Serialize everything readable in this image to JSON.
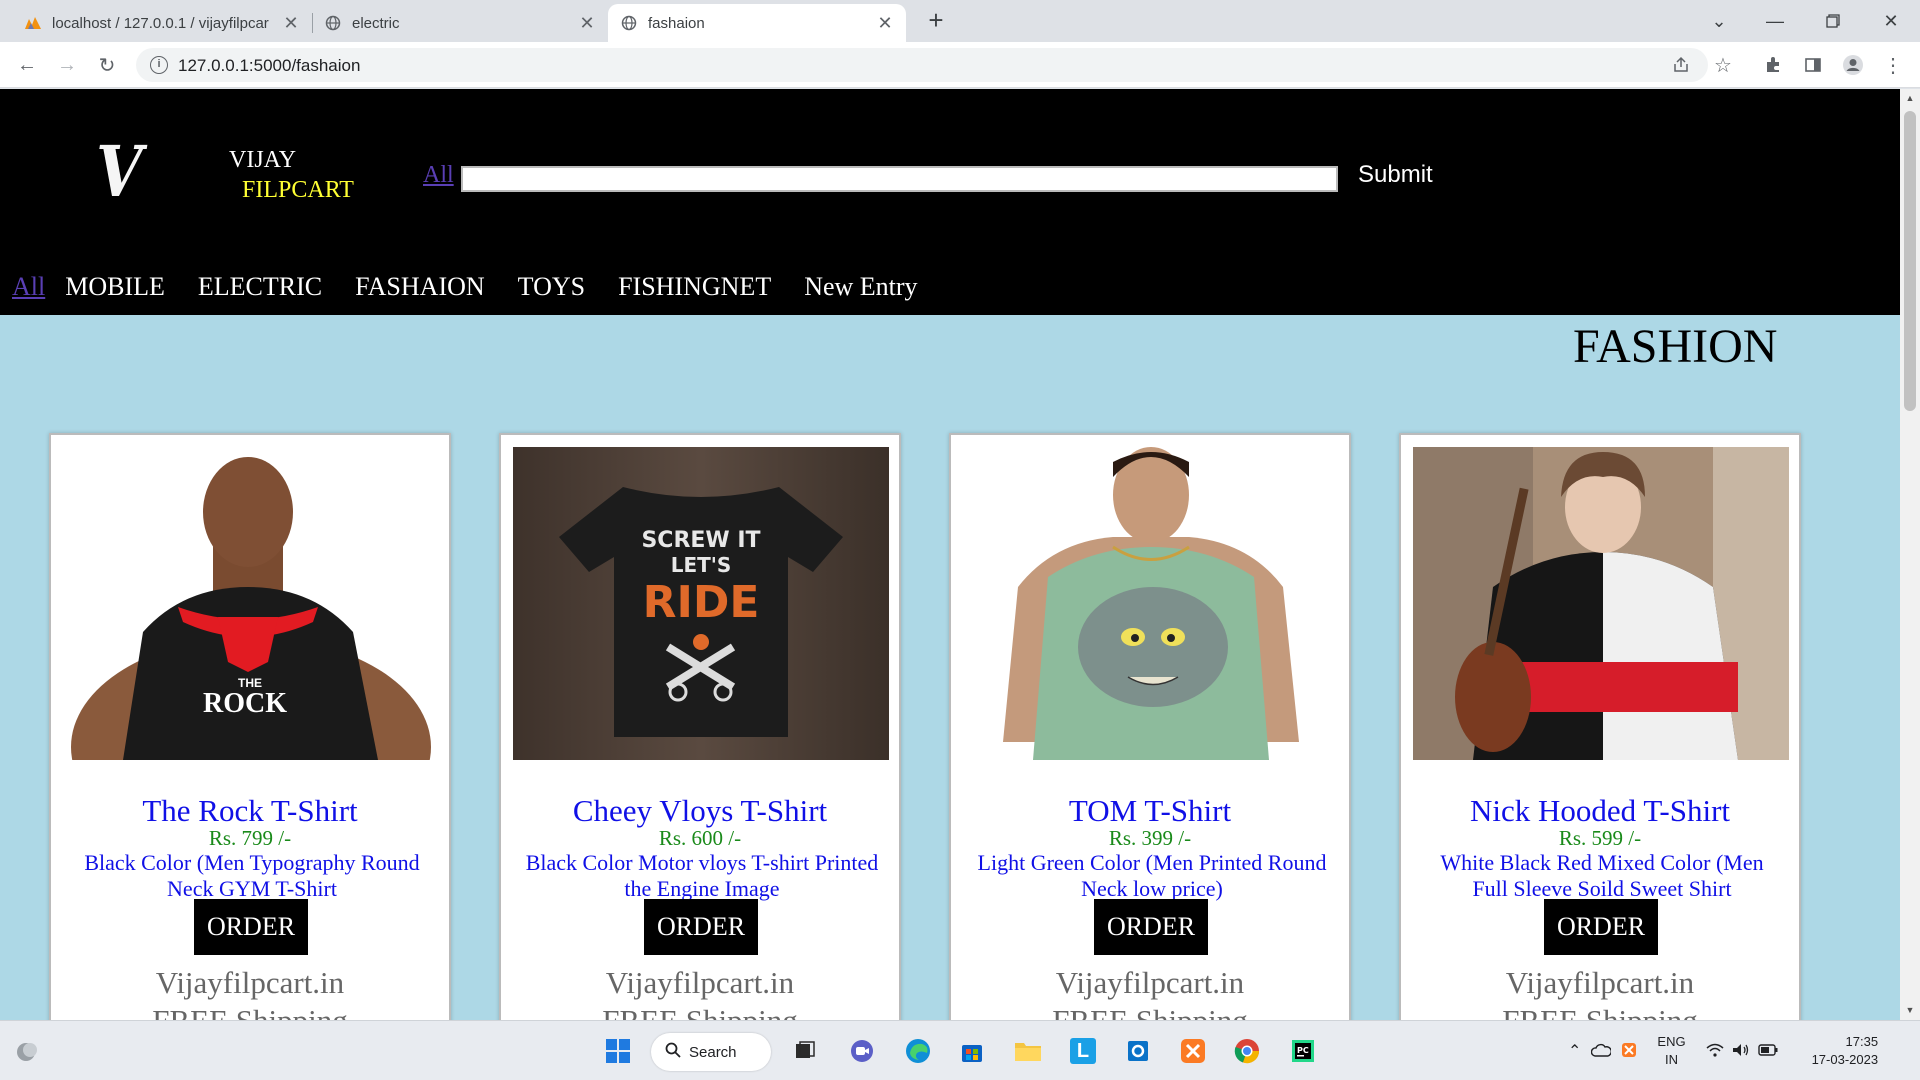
{
  "browser": {
    "tabs": [
      {
        "title": "localhost / 127.0.0.1 / vijayfilpcar",
        "icon": "phpmyadmin-icon"
      },
      {
        "title": "electric",
        "icon": "globe-icon"
      },
      {
        "title": "fashaion",
        "icon": "globe-icon"
      }
    ],
    "url": "127.0.0.1:5000/fashaion"
  },
  "header": {
    "logo_letter": "V",
    "brand_line1": "VIJAY",
    "brand_line2": "FILPCART",
    "search_all": "All",
    "search_value": "",
    "submit_label": "Submit"
  },
  "menu": {
    "all": "All",
    "items": [
      "MOBILE",
      "ELECTRIC",
      "FASHAION",
      "TOYS",
      "FISHINGNET",
      "New Entry"
    ]
  },
  "page_title": "FASHION",
  "products": [
    {
      "title": "The Rock T-Shirt",
      "price": "Rs. 799 /-",
      "desc": "Black Color (Men Typography Round Neck GYM T-Shirt",
      "order": "ORDER",
      "site": "Vijayfilpcart.in",
      "ship": "FREE Shipping"
    },
    {
      "title": "Cheey Vloys T-Shirt",
      "price": "Rs. 600 /-",
      "desc": "Black Color Motor vloys T-shirt Printed the Engine Image",
      "order": "ORDER",
      "site": "Vijayfilpcart.in",
      "ship": "FREE Shipping"
    },
    {
      "title": "TOM T-Shirt",
      "price": "Rs. 399 /-",
      "desc": "Light Green Color (Men Printed Round Neck low price)",
      "order": "ORDER",
      "site": "Vijayfilpcart.in",
      "ship": "FREE Shipping"
    },
    {
      "title": "Nick Hooded T-Shirt",
      "price": "Rs. 599 /-",
      "desc": "White Black Red Mixed Color (Men Full Sleeve Soild Sweet Shirt",
      "order": "ORDER",
      "site": "Vijayfilpcart.in",
      "ship": "FREE Shipping"
    }
  ],
  "shirt_prints": {
    "rock_line1": "THE",
    "rock_line2": "ROCK",
    "ride_line1": "SCREW IT",
    "ride_line2": "LET'S",
    "ride_line3": "RIDE"
  },
  "taskbar": {
    "search_label": "Search",
    "lang_line1": "ENG",
    "lang_line2": "IN",
    "time": "17:35",
    "date": "17-03-2023"
  },
  "colors": {
    "page_bg": "#add8e6",
    "header_bg": "#000000",
    "brand_yellow": "#ffff33",
    "title_blue": "#1010e6",
    "price_green": "#1a8a1a"
  }
}
